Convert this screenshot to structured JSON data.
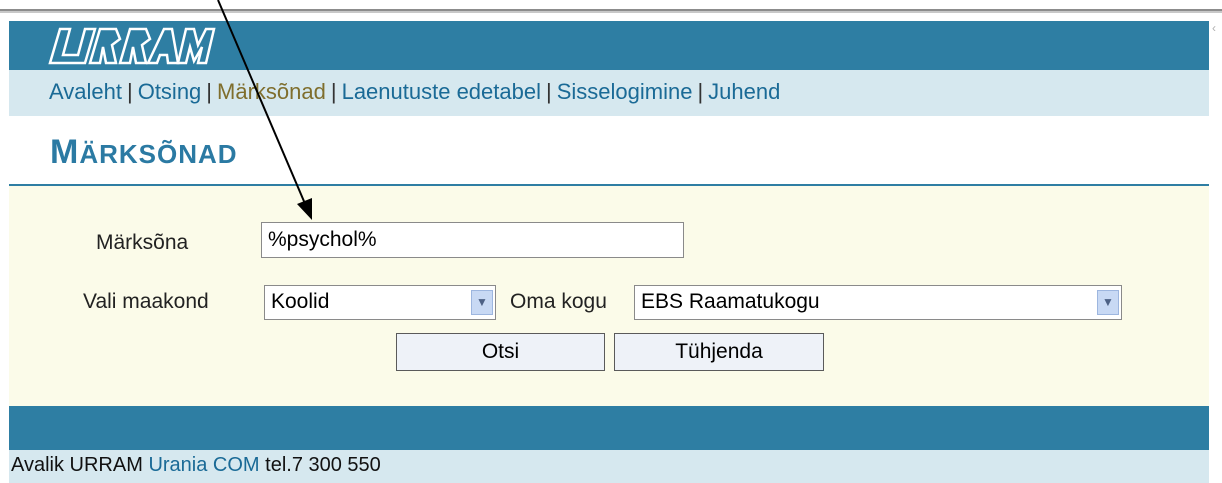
{
  "header": {
    "logo_text": "URRAM"
  },
  "nav": {
    "items": [
      {
        "label": "Avaleht",
        "active": false
      },
      {
        "label": "Otsing",
        "active": false
      },
      {
        "label": "Märksõnad",
        "active": true
      },
      {
        "label": "Laenutuste edetabel",
        "active": false
      },
      {
        "label": "Sisselogimine",
        "active": false
      },
      {
        "label": "Juhend",
        "active": false
      }
    ],
    "separator": "|"
  },
  "page": {
    "title_first": "M",
    "title_rest": "ÄRKSÕNAD"
  },
  "form": {
    "keyword_label": "Märksõna",
    "keyword_value": "%psychol%",
    "county_label": "Vali maakond",
    "county_value": "Koolid",
    "collection_label": "Oma kogu",
    "collection_value": "EBS Raamatukogu",
    "search_button": "Otsi",
    "clear_button": "Tühjenda"
  },
  "footer": {
    "prefix": "Avalik URRAM",
    "link": "Urania COM",
    "phone": "tel.7 300 550"
  },
  "colors": {
    "header_blue": "#2e7ea3",
    "nav_bg": "#d6e8ef",
    "form_bg": "#fbfbe9",
    "active_link": "#7f6e2d"
  },
  "icons": {
    "dropdown": "chevron-down-icon",
    "annotation": "annotation-arrow"
  }
}
